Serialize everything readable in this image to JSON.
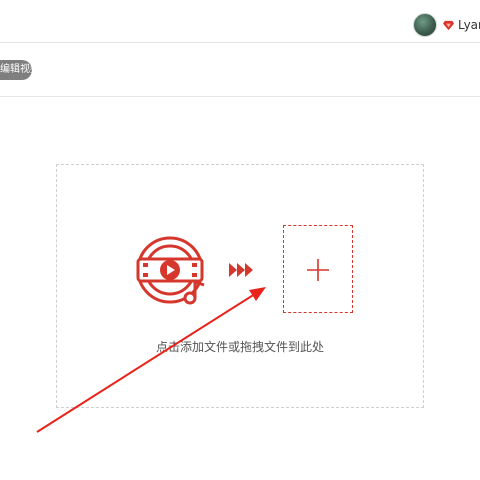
{
  "header": {
    "username": "Lyan"
  },
  "subbar": {
    "pill_label": "编辑视频"
  },
  "dropzone": {
    "hint": "点击添加文件或拖拽文件到此处",
    "media_icon": "video-music-icon",
    "arrows_icon": "forward-arrows-icon",
    "add_icon": "plus-icon"
  },
  "colors": {
    "accent": "#d6372d",
    "border": "#cfcfcf",
    "pill_bg": "#7f7f7f"
  }
}
